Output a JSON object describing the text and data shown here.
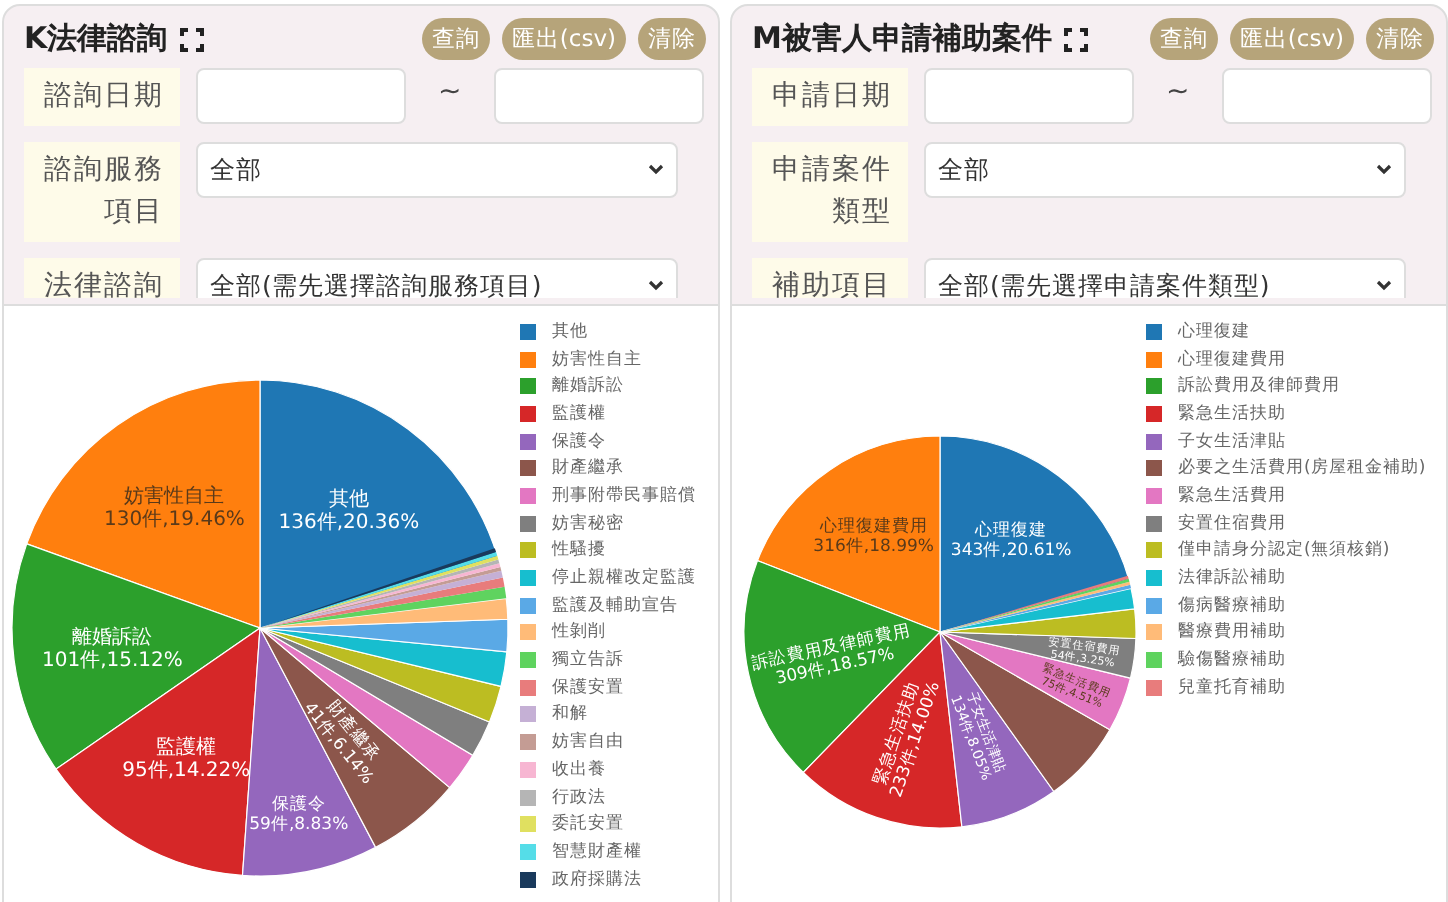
{
  "panels": [
    {
      "title": "K法律諮詢",
      "buttons": [
        "查詢",
        "匯出(csv)",
        "清除"
      ],
      "filters": [
        {
          "kind": "date_range",
          "label": "諮詢日期",
          "separator": "~"
        },
        {
          "kind": "select",
          "label": "諮詢服務項目",
          "value": "全部"
        },
        {
          "kind": "select",
          "label": "法律諮詢",
          "value": "全部(需先選擇諮詢服務項目)"
        }
      ],
      "chart_data": {
        "type": "pie",
        "legend": "right",
        "categories": [
          "其他",
          "妨害性自主",
          "離婚訴訟",
          "監護權",
          "保護令",
          "財產繼承",
          "刑事附帶民事賠償",
          "妨害秘密",
          "性騷擾",
          "停止親權改定監護",
          "監護及輔助宣告",
          "性剝削",
          "獨立告訴",
          "保護安置",
          "和解",
          "妨害自由",
          "收出養",
          "行政法",
          "委託安置",
          "智慧財產權",
          "政府採購法"
        ],
        "values": [
          136,
          130,
          101,
          95,
          59,
          41,
          17,
          16,
          16,
          15,
          14,
          9,
          5,
          4,
          3,
          1,
          1,
          1,
          1,
          1,
          1
        ],
        "colors": [
          "#1f77b4",
          "#ff7f0e",
          "#2ca02c",
          "#d62728",
          "#9467bd",
          "#8c564b",
          "#e377c2",
          "#7f7f7f",
          "#bcbd22",
          "#17becf",
          "#5aa9e6",
          "#ffbb78",
          "#5fd35f",
          "#e87c7c",
          "#c5b0d5",
          "#c49c94",
          "#f7b6d2",
          "#b5b5b5",
          "#e0e060",
          "#55dde8",
          "#1a3a5c"
        ],
        "value_labels": [
          "136件,20.36%",
          "130件,19.46%",
          "101件,15.12%",
          "95件,14.22%",
          "59件,8.83%",
          "41件,6.14%",
          null,
          null,
          null,
          null,
          null,
          null,
          null,
          null,
          null,
          null,
          null,
          null,
          null,
          null,
          null
        ]
      }
    },
    {
      "title": "M被害人申請補助案件",
      "buttons": [
        "查詢",
        "匯出(csv)",
        "清除"
      ],
      "filters": [
        {
          "kind": "date_range",
          "label": "申請日期",
          "separator": "~"
        },
        {
          "kind": "select",
          "label": "申請案件類型",
          "value": "全部"
        },
        {
          "kind": "select",
          "label": "補助項目",
          "value": "全部(需先選擇申請案件類型)"
        }
      ],
      "chart_data": {
        "type": "pie",
        "legend": "right",
        "categories": [
          "心理復建",
          "心理復建費用",
          "訴訟費用及律師費用",
          "緊急生活扶助",
          "子女生活津貼",
          "必要之生活費用(房屋租金補助)",
          "緊急生活費用",
          "安置住宿費用",
          "僅申請身分認定(無須核銷)",
          "法律訴訟補助",
          "傷病醫療補助",
          "醫療費用補助",
          "驗傷醫療補助",
          "兒童托育補助"
        ],
        "values": [
          343,
          316,
          309,
          233,
          134,
          113,
          75,
          54,
          40,
          28,
          5,
          4,
          2,
          1
        ],
        "colors": [
          "#1f77b4",
          "#ff7f0e",
          "#2ca02c",
          "#d62728",
          "#9467bd",
          "#8c564b",
          "#e377c2",
          "#7f7f7f",
          "#bcbd22",
          "#17becf",
          "#5aa9e6",
          "#ffbb78",
          "#5fd35f",
          "#e87c7c"
        ],
        "value_labels": [
          "343件,20.61%",
          "316件,18.99%",
          "309件,18.57%",
          "233件,14.00%",
          "134件,8.05%",
          null,
          "75件,4.51%",
          "54件,3.25%",
          null,
          null,
          null,
          null,
          null,
          null
        ]
      }
    }
  ]
}
